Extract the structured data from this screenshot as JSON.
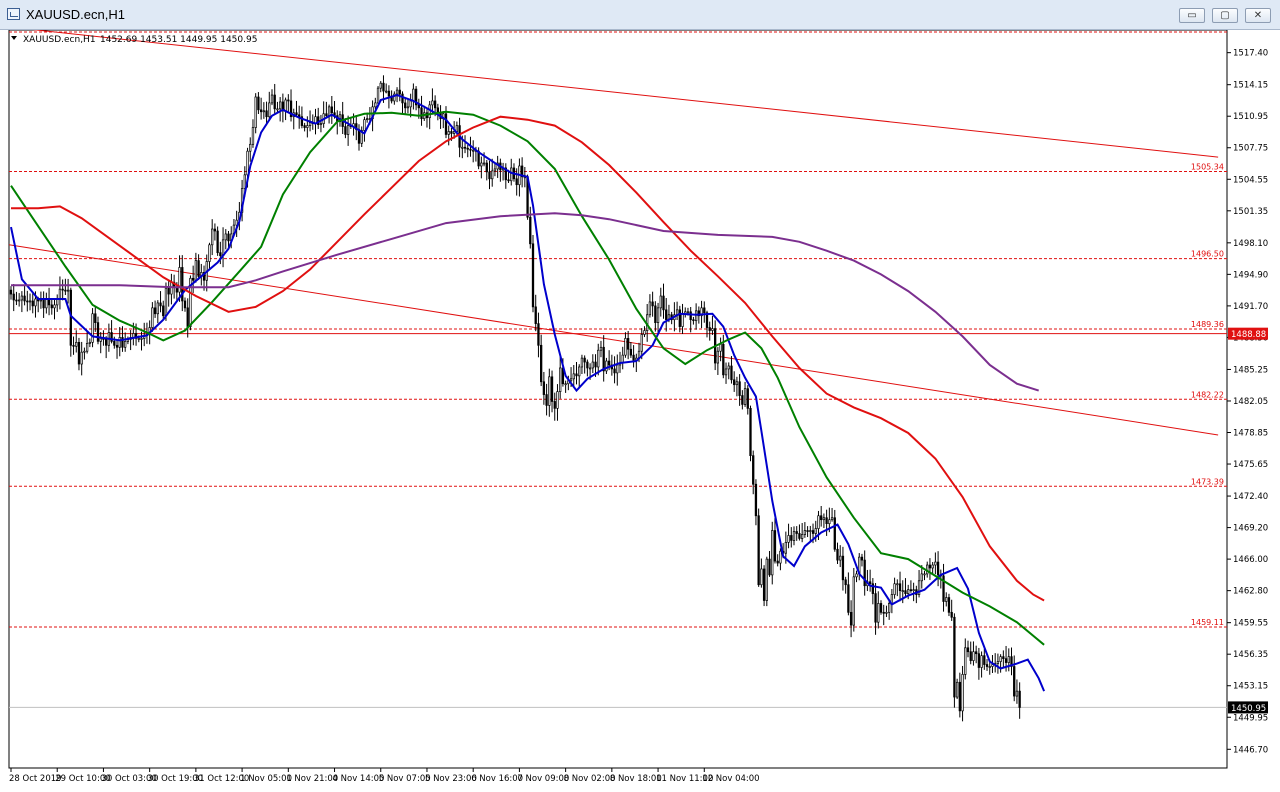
{
  "window": {
    "title": "XAUUSD.ecn,H1",
    "buttons": {
      "minimize": "▭",
      "restore": "▢",
      "close": "✕"
    }
  },
  "chart_header": {
    "symbol": "XAUUSD.ecn,H1",
    "ohlc": "1452.69 1453.51 1449.95 1450.95"
  },
  "chart_data": {
    "type": "candlestick",
    "symbol": "XAUUSD.ecn",
    "timeframe": "H1",
    "ylim": [
      1444.8,
      1519.7
    ],
    "y_ticks": [
      1517.4,
      1514.15,
      1510.95,
      1507.75,
      1504.55,
      1501.35,
      1498.1,
      1494.9,
      1491.7,
      1488.5,
      1485.25,
      1482.05,
      1478.85,
      1475.65,
      1472.4,
      1469.2,
      1466.0,
      1462.8,
      1459.55,
      1456.35,
      1453.15,
      1449.95,
      1446.7
    ],
    "x_ticks": [
      "28 Oct 2019",
      "29 Oct 10:00",
      "30 Oct 03:00",
      "30 Oct 19:00",
      "31 Oct 12:00",
      "1 Nov 05:00",
      "1 Nov 21:00",
      "4 Nov 14:00",
      "5 Nov 07:00",
      "5 Nov 23:00",
      "6 Nov 16:00",
      "7 Nov 09:00",
      "8 Nov 02:00",
      "8 Nov 18:00",
      "11 Nov 11:00",
      "12 Nov 04:00"
    ],
    "bars_per_tick": 17,
    "last_price": 1450.95,
    "price_line_label": "1488.88",
    "price_line_value": 1488.88,
    "horizontal_levels": [
      1505.34,
      1496.5,
      1489.36,
      1482.22,
      1473.39,
      1459.11
    ],
    "level_color": "#e01010",
    "trendlines": [
      {
        "from": [
          "28 Oct 2019",
          1520.0
        ],
        "to": [
          "12 Nov 04:00 +73 bars",
          1506.8
        ]
      },
      {
        "from": [
          "28 Oct 2019",
          1497.9
        ],
        "to": [
          "12 Nov 04:00 +73 bars",
          1478.6
        ]
      }
    ],
    "closes": [
      1492.9,
      1492.3,
      1492.2,
      1492.3,
      1492.7,
      1492.2,
      1492.1,
      1492.2,
      1491.7,
      1492.4,
      1492.2,
      1492.3,
      1491.5,
      1492.4,
      1491.8,
      1491.5,
      1491.8,
      1492.4,
      1493.4,
      1493.3,
      1493.2,
      1493.3,
      1487.7,
      1487.6,
      1488.0,
      1485.8,
      1487.0,
      1487.1,
      1487.9,
      1488.0,
      1490.9,
      1490.0,
      1488.1,
      1488.4,
      1488.3,
      1487.7,
      1489.0,
      1488.1,
      1487.7,
      1487.5,
      1488.5,
      1487.5,
      1488.1,
      1488.3,
      1488.5,
      1488.9,
      1488.4,
      1488.4,
      1488.4,
      1488.7,
      1488.8,
      1489.5,
      1491.5,
      1490.9,
      1492.0,
      1491.7,
      1490.7,
      1493.5,
      1492.9,
      1494.1,
      1493.6,
      1493.1,
      1495.6,
      1492.2,
      1491.5,
      1489.6,
      1494.5,
      1494.3,
      1496.3,
      1494.7,
      1495.1,
      1494.3,
      1496.2,
      1497.9,
      1499.5,
      1499.3,
      1497.1,
      1496.8,
      1498.4,
      1499.0,
      1498.3,
      1499.0,
      1499.9,
      1500.4,
      1501.2,
      1503.6,
      1505.0,
      1507.4,
      1508.1,
      1509.8,
      1512.9,
      1511.6,
      1511.4,
      1511.5,
      1510.9,
      1512.3,
      1513.1,
      1511.7,
      1511.7,
      1512.4,
      1511.5,
      1512.6,
      1512.5,
      1510.9,
      1511.3,
      1511.1,
      1510.9,
      1510.0,
      1509.8,
      1510.0,
      1510.3,
      1510.2,
      1510.9,
      1510.1,
      1510.2,
      1511.2,
      1511.0,
      1511.9,
      1511.3,
      1511.0,
      1510.4,
      1511.1,
      1509.9,
      1509.1,
      1510.0,
      1509.9,
      1510.2,
      1509.6,
      1508.2,
      1509.5,
      1510.6,
      1510.7,
      1510.7,
      1511.9,
      1512.3,
      1513.8,
      1514.3,
      1513.5,
      1513.5,
      1513.0,
      1512.5,
      1513.2,
      1513.6,
      1513.2,
      1512.3,
      1511.8,
      1511.9,
      1512.5,
      1513.7,
      1512.1,
      1511.8,
      1510.7,
      1511.3,
      1510.8,
      1512.1,
      1512.5,
      1511.8,
      1511.3,
      1510.7,
      1511.2,
      1509.1,
      1509.4,
      1509.2,
      1509.4,
      1510.0,
      1507.8,
      1507.8,
      1507.7,
      1507.6,
      1507.5,
      1507.5,
      1507.4,
      1505.9,
      1506.2,
      1506.2,
      1505.3,
      1504.6,
      1505.4,
      1505.6,
      1506.2,
      1505.5,
      1505.7,
      1504.5,
      1504.4,
      1505.7,
      1504.6,
      1504.0,
      1505.9,
      1504.8,
      1504.8,
      1500.7,
      1498.0,
      1491.6,
      1489.9,
      1487.7,
      1484.0,
      1482.7,
      1481.6,
      1484.5,
      1482.0,
      1481.3,
      1483.0,
      1485.4,
      1483.8,
      1483.8,
      1484.1,
      1484.3,
      1484.8,
      1484.6,
      1485.5,
      1486.4,
      1486.0,
      1485.4,
      1485.4,
      1486.0,
      1485.5,
      1487.2,
      1487.5,
      1485.1,
      1486.1,
      1485.7,
      1485.3,
      1484.9,
      1485.7,
      1485.9,
      1486.7,
      1488.4,
      1487.3,
      1486.7,
      1486.2,
      1486.4,
      1487.1,
      1488.8,
      1489.2,
      1490.8,
      1492.1,
      1491.7,
      1490.0,
      1491.5,
      1492.7,
      1491.3,
      1490.3,
      1490.8,
      1490.3,
      1490.8,
      1491.3,
      1489.6,
      1490.9,
      1491.1,
      1491.1,
      1490.3,
      1490.2,
      1491.2,
      1490.7,
      1491.5,
      1491.0,
      1489.5,
      1489.2,
      1489.4,
      1485.9,
      1487.1,
      1487.8,
      1484.7,
      1485.3,
      1485.6,
      1484.2,
      1483.7,
      1484.0,
      1482.6,
      1481.7,
      1483.3,
      1481.3,
      1476.5,
      1473.6,
      1470.4,
      1463.4,
      1465.0,
      1461.8,
      1466.0,
      1464.4,
      1468.9,
      1465.8,
      1465.6,
      1466.8,
      1466.6,
      1467.7,
      1468.4,
      1467.9,
      1468.8,
      1468.6,
      1468.1,
      1468.5,
      1468.9,
      1468.8,
      1468.9,
      1468.6,
      1469.1,
      1470.4,
      1470.0,
      1470.2,
      1469.6,
      1470.0,
      1470.2,
      1467.0,
      1465.9,
      1466.3,
      1463.9,
      1463.4,
      1460.6,
      1459.3,
      1464.2,
      1464.5,
      1466.2,
      1465.9,
      1463.3,
      1463.7,
      1463.5,
      1462.5,
      1459.6,
      1461.5,
      1460.6,
      1460.5,
      1460.6,
      1461.5,
      1462.4,
      1463.5,
      1463.5,
      1462.8,
      1462.8,
      1462.5,
      1462.9,
      1462.8,
      1462.9,
      1462.4,
      1463.8,
      1464.5,
      1464.5,
      1465.4,
      1465.1,
      1465.4,
      1465.7,
      1464.4,
      1464.3,
      1461.7,
      1462.1,
      1460.6,
      1460.1,
      1452.0,
      1453.5,
      1450.6,
      1454.3,
      1457.0,
      1456.6,
      1455.7,
      1456.6,
      1456.4,
      1455.0,
      1456.2,
      1455.3,
      1455.1,
      1455.1,
      1455.3,
      1455.4,
      1455.6,
      1456.1,
      1455.9,
      1455.5,
      1456.1,
      1455.1,
      1452.1,
      1452.6,
      1450.95
    ],
    "moving_averages": [
      {
        "color": "#0000cc",
        "points": [
          [
            0,
            1499.7
          ],
          [
            4,
            1494.4
          ],
          [
            10,
            1492.4
          ],
          [
            20,
            1492.4
          ],
          [
            22,
            1490.7
          ],
          [
            30,
            1488.6
          ],
          [
            40,
            1488.2
          ],
          [
            50,
            1488.7
          ],
          [
            56,
            1490.3
          ],
          [
            64,
            1493.3
          ],
          [
            70,
            1494.7
          ],
          [
            76,
            1496.1
          ],
          [
            80,
            1497.5
          ],
          [
            84,
            1500.3
          ],
          [
            88,
            1505.9
          ],
          [
            92,
            1509.3
          ],
          [
            96,
            1511.0
          ],
          [
            100,
            1511.6
          ],
          [
            106,
            1510.8
          ],
          [
            112,
            1510.2
          ],
          [
            118,
            1511.1
          ],
          [
            124,
            1510.2
          ],
          [
            130,
            1509.2
          ],
          [
            136,
            1512.6
          ],
          [
            142,
            1513.1
          ],
          [
            148,
            1512.5
          ],
          [
            154,
            1511.6
          ],
          [
            160,
            1510.6
          ],
          [
            166,
            1508.6
          ],
          [
            172,
            1507.3
          ],
          [
            178,
            1506.2
          ],
          [
            184,
            1505.2
          ],
          [
            190,
            1504.8
          ],
          [
            192,
            1501.9
          ],
          [
            196,
            1493.9
          ],
          [
            200,
            1488.8
          ],
          [
            204,
            1484.6
          ],
          [
            208,
            1483.1
          ],
          [
            212,
            1484.3
          ],
          [
            218,
            1485.3
          ],
          [
            224,
            1485.9
          ],
          [
            230,
            1486.1
          ],
          [
            236,
            1487.7
          ],
          [
            240,
            1490.0
          ],
          [
            246,
            1490.9
          ],
          [
            252,
            1490.8
          ],
          [
            258,
            1490.9
          ],
          [
            262,
            1489.6
          ],
          [
            266,
            1486.7
          ],
          [
            270,
            1484.4
          ],
          [
            274,
            1482.5
          ],
          [
            276,
            1479.0
          ],
          [
            280,
            1471.9
          ],
          [
            284,
            1466.3
          ],
          [
            288,
            1465.3
          ],
          [
            292,
            1467.3
          ],
          [
            298,
            1468.7
          ],
          [
            304,
            1469.5
          ],
          [
            308,
            1467.5
          ],
          [
            312,
            1464.5
          ],
          [
            316,
            1463.3
          ],
          [
            320,
            1463.1
          ],
          [
            324,
            1461.4
          ],
          [
            330,
            1462.3
          ],
          [
            336,
            1462.9
          ],
          [
            342,
            1464.4
          ],
          [
            348,
            1465.1
          ],
          [
            352,
            1463.0
          ],
          [
            356,
            1458.5
          ],
          [
            360,
            1455.6
          ],
          [
            364,
            1454.9
          ],
          [
            370,
            1455.4
          ],
          [
            374,
            1455.8
          ],
          [
            378,
            1453.9
          ],
          [
            380,
            1452.6
          ]
        ]
      },
      {
        "color": "#008000",
        "points": [
          [
            0,
            1503.9
          ],
          [
            8,
            1500.6
          ],
          [
            20,
            1495.7
          ],
          [
            30,
            1491.8
          ],
          [
            40,
            1490.2
          ],
          [
            50,
            1489.0
          ],
          [
            56,
            1488.2
          ],
          [
            64,
            1489.2
          ],
          [
            74,
            1492.1
          ],
          [
            84,
            1495.2
          ],
          [
            92,
            1497.7
          ],
          [
            100,
            1503.0
          ],
          [
            110,
            1507.3
          ],
          [
            120,
            1510.4
          ],
          [
            130,
            1511.2
          ],
          [
            140,
            1511.3
          ],
          [
            150,
            1511.0
          ],
          [
            160,
            1511.4
          ],
          [
            170,
            1511.1
          ],
          [
            180,
            1510.0
          ],
          [
            190,
            1508.4
          ],
          [
            200,
            1505.6
          ],
          [
            210,
            1500.8
          ],
          [
            220,
            1496.4
          ],
          [
            230,
            1491.4
          ],
          [
            240,
            1487.4
          ],
          [
            248,
            1485.8
          ],
          [
            256,
            1487.2
          ],
          [
            264,
            1488.3
          ],
          [
            270,
            1489.0
          ],
          [
            276,
            1487.4
          ],
          [
            282,
            1484.4
          ],
          [
            290,
            1479.4
          ],
          [
            300,
            1474.3
          ],
          [
            310,
            1470.2
          ],
          [
            320,
            1466.6
          ],
          [
            330,
            1466.0
          ],
          [
            340,
            1464.3
          ],
          [
            350,
            1462.6
          ],
          [
            360,
            1461.2
          ],
          [
            370,
            1459.6
          ],
          [
            380,
            1457.3
          ]
        ]
      },
      {
        "color": "#e01010",
        "points": [
          [
            0,
            1501.6
          ],
          [
            10,
            1501.6
          ],
          [
            18,
            1501.8
          ],
          [
            26,
            1500.6
          ],
          [
            40,
            1497.8
          ],
          [
            56,
            1494.6
          ],
          [
            68,
            1492.7
          ],
          [
            80,
            1491.1
          ],
          [
            90,
            1491.6
          ],
          [
            100,
            1493.2
          ],
          [
            110,
            1495.4
          ],
          [
            120,
            1498.2
          ],
          [
            130,
            1501.0
          ],
          [
            140,
            1503.7
          ],
          [
            150,
            1506.4
          ],
          [
            160,
            1508.4
          ],
          [
            170,
            1509.8
          ],
          [
            180,
            1510.9
          ],
          [
            190,
            1510.6
          ],
          [
            200,
            1510.0
          ],
          [
            210,
            1508.3
          ],
          [
            220,
            1506.0
          ],
          [
            230,
            1503.2
          ],
          [
            240,
            1500.2
          ],
          [
            250,
            1497.3
          ],
          [
            260,
            1494.7
          ],
          [
            270,
            1492.0
          ],
          [
            280,
            1488.6
          ],
          [
            290,
            1485.4
          ],
          [
            300,
            1482.8
          ],
          [
            310,
            1481.4
          ],
          [
            320,
            1480.3
          ],
          [
            330,
            1478.8
          ],
          [
            340,
            1476.2
          ],
          [
            350,
            1472.3
          ],
          [
            360,
            1467.3
          ],
          [
            370,
            1463.8
          ],
          [
            376,
            1462.4
          ],
          [
            380,
            1461.8
          ]
        ]
      },
      {
        "color": "#7b2f8f",
        "points": [
          [
            0,
            1493.8
          ],
          [
            20,
            1493.8
          ],
          [
            40,
            1493.8
          ],
          [
            60,
            1493.6
          ],
          [
            80,
            1493.6
          ],
          [
            90,
            1494.3
          ],
          [
            100,
            1495.2
          ],
          [
            120,
            1496.9
          ],
          [
            140,
            1498.5
          ],
          [
            160,
            1500.1
          ],
          [
            180,
            1500.8
          ],
          [
            200,
            1501.1
          ],
          [
            210,
            1500.9
          ],
          [
            220,
            1500.5
          ],
          [
            240,
            1499.3
          ],
          [
            260,
            1498.9
          ],
          [
            280,
            1498.7
          ],
          [
            290,
            1498.2
          ],
          [
            300,
            1497.3
          ],
          [
            310,
            1496.3
          ],
          [
            320,
            1494.9
          ],
          [
            330,
            1493.2
          ],
          [
            340,
            1491.1
          ],
          [
            350,
            1488.6
          ],
          [
            360,
            1485.7
          ],
          [
            370,
            1483.8
          ],
          [
            378,
            1483.1
          ]
        ]
      }
    ]
  }
}
